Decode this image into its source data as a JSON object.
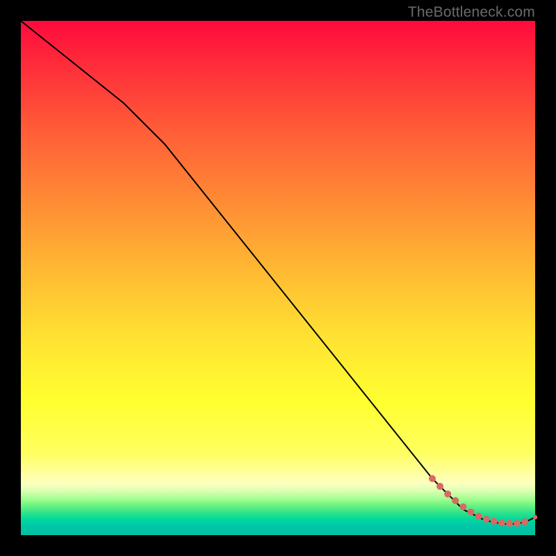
{
  "watermark": "TheBottleneck.com",
  "colors": {
    "background": "#000000",
    "line": "#000000",
    "dots": "#d86a64"
  },
  "chart_data": {
    "type": "line",
    "title": "",
    "xlabel": "",
    "ylabel": "",
    "xlim": [
      0,
      100
    ],
    "ylim": [
      0,
      100
    ],
    "grid": false,
    "series": [
      {
        "name": "curve",
        "style": "line",
        "color": "#000000",
        "x": [
          0,
          5,
          10,
          15,
          20,
          24,
          28,
          32,
          36,
          40,
          44,
          48,
          52,
          56,
          60,
          64,
          68,
          72,
          76,
          80,
          82,
          84,
          86,
          88,
          90,
          92,
          94,
          96,
          98,
          100
        ],
        "y": [
          100,
          96,
          92,
          88,
          84,
          80,
          76,
          71,
          66,
          61,
          56,
          51,
          46,
          41,
          36,
          31,
          26,
          21,
          16,
          11,
          9,
          7,
          5,
          4,
          3,
          2.5,
          2.2,
          2.2,
          2.5,
          3.5
        ]
      },
      {
        "name": "bottom-markers",
        "style": "scatter",
        "color": "#d86a64",
        "x": [
          80,
          81.5,
          83,
          84.5,
          86,
          87.5,
          89,
          90.5,
          92,
          93.5,
          95,
          96.5,
          98,
          100
        ],
        "y": [
          11,
          9.5,
          8,
          6.7,
          5.5,
          4.5,
          3.7,
          3.1,
          2.7,
          2.4,
          2.3,
          2.3,
          2.6,
          3.5
        ]
      }
    ]
  }
}
